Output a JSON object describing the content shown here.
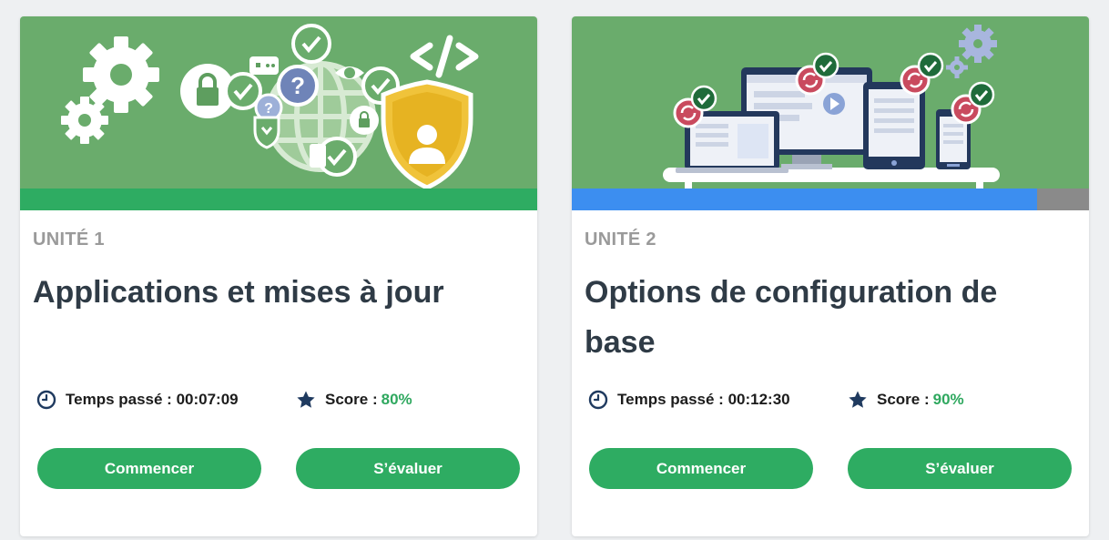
{
  "cards": [
    {
      "unit": "UNITÉ 1",
      "title": "Applications et mises à jour",
      "progress": 1.0,
      "progress_color": "#2eac62",
      "time_label": "Temps passé : 00:07:09",
      "score_label": "Score :",
      "score_value": "80%",
      "start_label": "Commencer",
      "eval_label": "S’évaluer",
      "banner_icons": [
        "gear-icon",
        "lock-icon",
        "question-icon",
        "globe-icon",
        "check-icon",
        "shield-user-icon",
        "code-icon",
        "eye-icon"
      ]
    },
    {
      "unit": "UNITÉ 2",
      "title": "Options de configuration de base",
      "progress": 0.9,
      "progress_color": "#3c8ef0",
      "time_label": "Temps passé : 00:12:30",
      "score_label": "Score :",
      "score_value": "90%",
      "start_label": "Commencer",
      "eval_label": "S’évaluer",
      "banner_icons": [
        "laptop-icon",
        "monitor-icon",
        "tablet-icon",
        "phone-icon",
        "sync-icon",
        "check-icon",
        "gear-icon",
        "play-icon"
      ]
    }
  ],
  "colors": {
    "banner": "#6aac6c",
    "button": "#2eac62",
    "score": "#2fa85f",
    "icon_navy": "#1f3a5f",
    "progress_track": "#8a8a8a"
  }
}
